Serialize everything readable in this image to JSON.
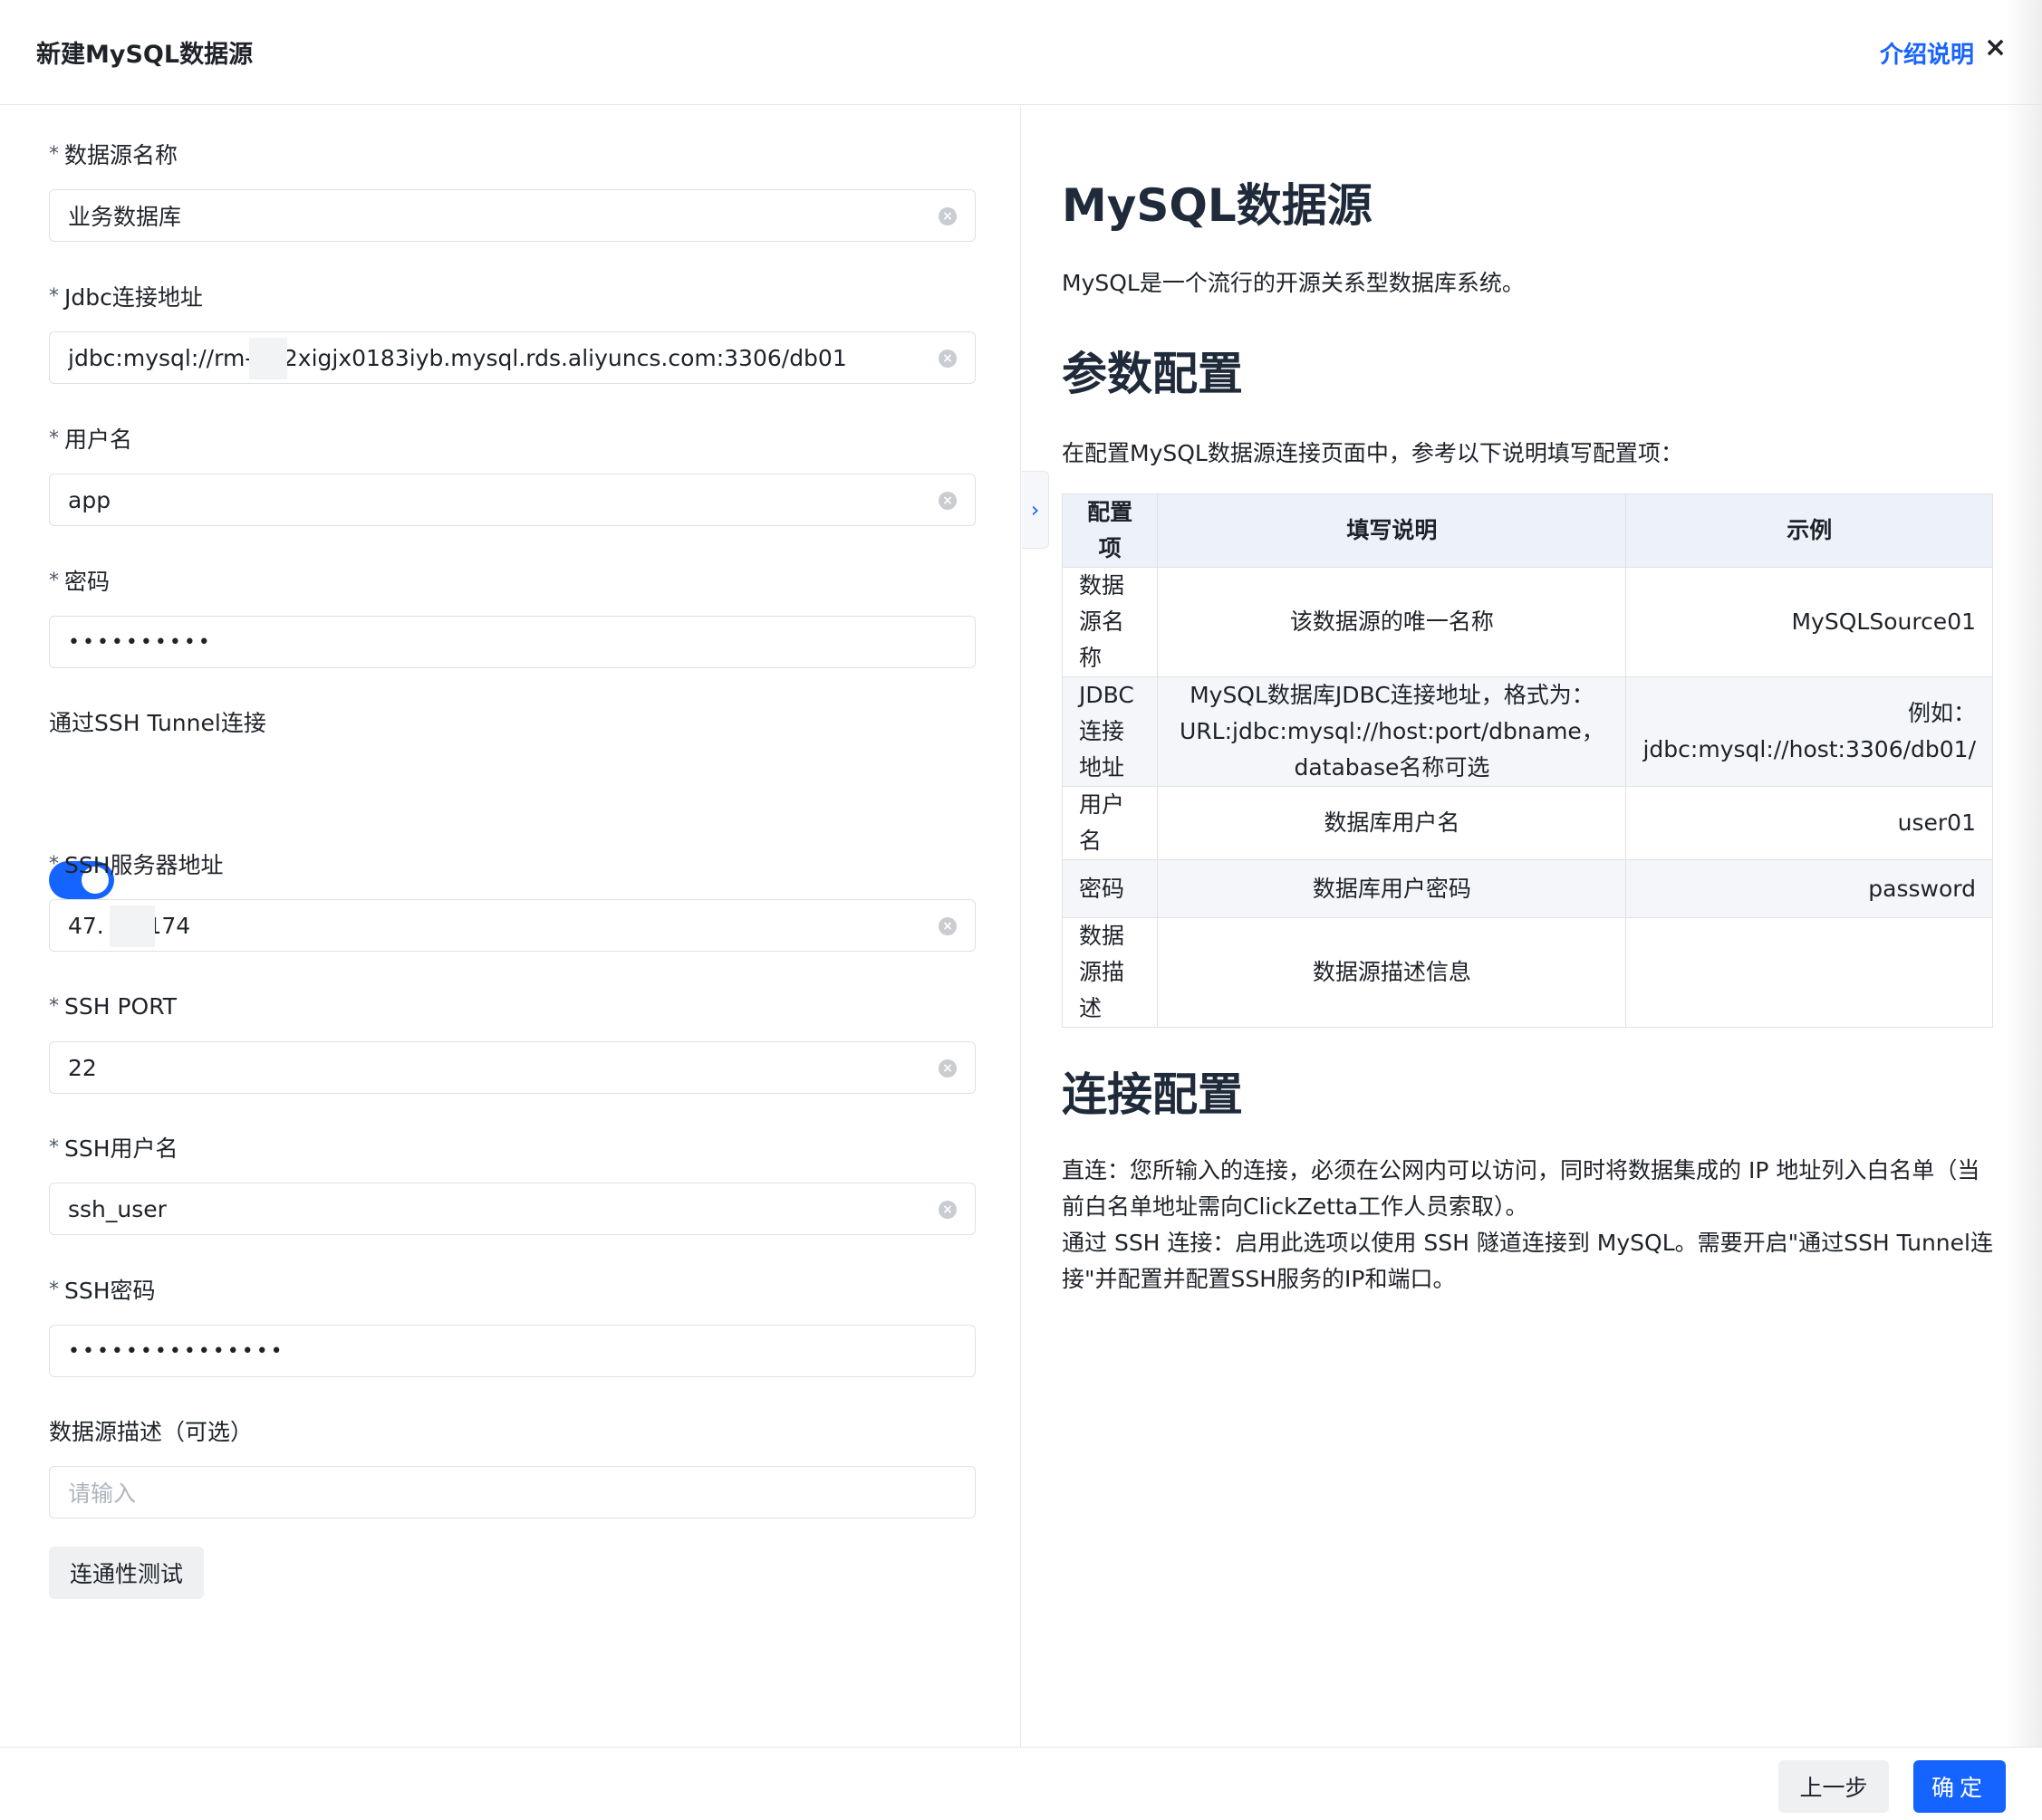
{
  "header": {
    "title": "新建MySQL数据源",
    "intro_link": "介绍说明",
    "close": "×"
  },
  "form": {
    "name": {
      "required": "*",
      "label": "数据源名称",
      "value": "业务数据库"
    },
    "jdbc": {
      "required": "*",
      "label": "Jdbc连接地址",
      "value": "jdbc:mysql://rm-a    r2xigjx0183iyb.mysql.rds.aliyuncs.com:3306/db01"
    },
    "username": {
      "required": "*",
      "label": "用户名",
      "value": "app"
    },
    "password": {
      "required": "*",
      "label": "密码",
      "value": "••••••••••"
    },
    "ssh_tunnel": {
      "label": "通过SSH Tunnel连接",
      "enabled": true
    },
    "ssh_host": {
      "required": "*",
      "label": "SSH服务器地址",
      "value": "47.     53.174"
    },
    "ssh_port": {
      "required": "*",
      "label": "SSH PORT",
      "value": "22"
    },
    "ssh_user": {
      "required": "*",
      "label": "SSH用户名",
      "value": "ssh_user"
    },
    "ssh_password": {
      "required": "*",
      "label": "SSH密码",
      "value": "•••••••••••••••"
    },
    "description": {
      "label": "数据源描述（可选）",
      "placeholder": "请输入"
    },
    "test_button": "连通性测试"
  },
  "collapse_handle": "›",
  "doc": {
    "title": "MySQL数据源",
    "intro": "MySQL是一个流行的开源关系型数据库系统。",
    "params_title": "参数配置",
    "params_intro": "在配置MySQL数据源连接页面中，参考以下说明填写配置项：",
    "table": {
      "headers": [
        "配置项",
        "填写说明",
        "示例"
      ],
      "rows": [
        [
          "数据源名称",
          "该数据源的唯一名称",
          "MySQLSource01"
        ],
        [
          "JDBC连接地址",
          "MySQL数据库JDBC连接地址，格式为：URL:jdbc:mysql://host:port/dbname，database名称可选",
          "例如：jdbc:mysql://host:3306/db01/"
        ],
        [
          "用户名",
          "数据库用户名",
          "user01"
        ],
        [
          "密码",
          "数据库用户密码",
          "password"
        ],
        [
          "数据源描述",
          "数据源描述信息",
          ""
        ]
      ]
    },
    "conn_title": "连接配置",
    "conn_direct": "直连：您所输入的连接，必须在公网内可以访问，同时将数据集成的 IP 地址列入白名单（当前白名单地址需向ClickZetta工作人员索取）。",
    "conn_ssh": "通过 SSH 连接：启用此选项以使用 SSH 隧道连接到 MySQL。需要开启\"通过SSH Tunnel连接\"并配置并配置SSH服务的IP和端口。"
  },
  "footer": {
    "prev": "上一步",
    "ok": "确定"
  },
  "colors": {
    "accent": "#1664ff",
    "table_header_bg": "#edf2fa"
  }
}
